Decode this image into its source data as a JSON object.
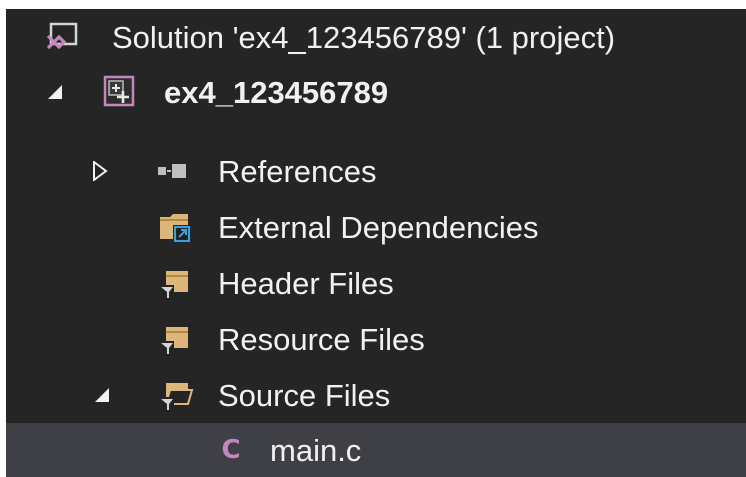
{
  "tree": {
    "solution_label": "Solution 'ex4_123456789' (1 project)",
    "project_label": "ex4_123456789",
    "items": [
      {
        "label": "References"
      },
      {
        "label": "External Dependencies"
      },
      {
        "label": "Header Files"
      },
      {
        "label": "Resource Files"
      },
      {
        "label": "Source Files"
      }
    ],
    "file_label": "main.c"
  },
  "colors": {
    "background": "#252526",
    "selection": "#3f3f46",
    "text": "#f1f1f1",
    "folder": "#dcb67a",
    "vs_purple": "#c586c0",
    "accent_blue": "#3b9fd9"
  },
  "icons": {
    "solution": "solution-icon",
    "project": "project-icon",
    "references": "references-icon",
    "external": "folder-link-icon",
    "folder": "filter-folder-icon",
    "c_file": "c-file-icon"
  }
}
